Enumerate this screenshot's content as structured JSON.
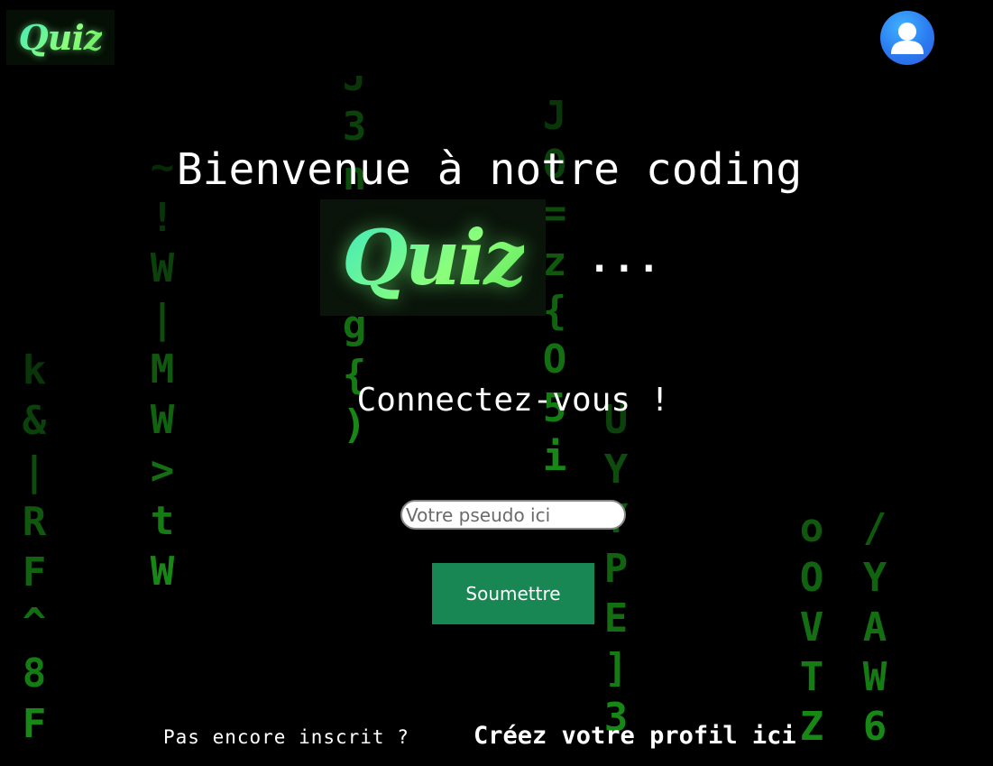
{
  "header": {
    "logo_text": "Quiz",
    "avatar_icon": "user-avatar-icon"
  },
  "main": {
    "welcome_text": "Bienvenue à notre coding",
    "logo_text": "Quiz",
    "ellipsis": "...",
    "connect_heading": "Connectez-vous !",
    "pseudo_placeholder": "Votre pseudo ici",
    "pseudo_value": "",
    "submit_label": "Soumettre"
  },
  "footer": {
    "not_registered_text": "Pas encore inscrit ?",
    "create_profile_link": "Créez votre profil ici"
  },
  "colors": {
    "background": "#000000",
    "matrix_green": "#22c41e",
    "submit_button": "#198754",
    "logo_gradient_start": "#3ee8c0",
    "logo_gradient_end": "#8cff7a",
    "avatar_blue": "#2b7bf0"
  },
  "background_rain": [
    {
      "ch": [
        "k",
        "&",
        "|",
        "R",
        "F",
        "^",
        "8",
        "F"
      ]
    },
    {
      "ch": [
        "~",
        "!",
        "W",
        "|",
        "M",
        "W",
        ">",
        "t",
        "W"
      ]
    },
    {
      "ch": [
        "J",
        "3",
        "n",
        "I",
        "~",
        "g",
        "{",
        ")"
      ]
    },
    {
      "ch": [
        "J",
        "O",
        "=",
        "z",
        "{",
        "O",
        "5",
        "i"
      ]
    },
    {
      "ch": [
        "U",
        "Y",
        "Y",
        "P",
        "E",
        "]",
        "3"
      ]
    },
    {
      "ch": [
        "o",
        "O",
        "V",
        "T",
        "Z"
      ]
    },
    {
      "ch": [
        "/",
        "Y",
        "A",
        "W",
        "6"
      ]
    }
  ]
}
